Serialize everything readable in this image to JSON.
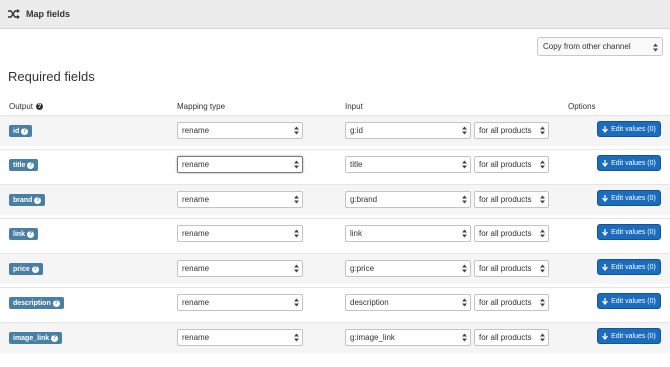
{
  "header": {
    "title": "Map fields",
    "icon": "shuffle-icon"
  },
  "copy_select": {
    "value": "Copy from other channel"
  },
  "section_title": "Required fields",
  "columns": {
    "output": "Output",
    "mapping_type": "Mapping type",
    "input": "Input",
    "options": "Options"
  },
  "edit_button_label": "Edit values (0)",
  "rows": [
    {
      "output": "id",
      "mapping": "rename",
      "input": "g:id",
      "scope": "for all products",
      "edit": "Edit values (0)"
    },
    {
      "output": "title",
      "mapping": "rename",
      "input": "title",
      "scope": "for all products",
      "edit": "Edit values (0)"
    },
    {
      "output": "brand",
      "mapping": "rename",
      "input": "g:brand",
      "scope": "for all products",
      "edit": "Edit values (0)"
    },
    {
      "output": "link",
      "mapping": "rename",
      "input": "link",
      "scope": "for all products",
      "edit": "Edit values (0)"
    },
    {
      "output": "price",
      "mapping": "rename",
      "input": "g:price",
      "scope": "for all products",
      "edit": "Edit values (0)"
    },
    {
      "output": "description",
      "mapping": "rename",
      "input": "description",
      "scope": "for all products",
      "edit": "Edit values (0)"
    },
    {
      "output": "image_link",
      "mapping": "rename",
      "input": "g:image_link",
      "scope": "for all products",
      "edit": "Edit values (0)"
    }
  ],
  "colors": {
    "badge": "#4a7fa5",
    "button": "#1b6bbf",
    "header_bg": "#ececec"
  }
}
